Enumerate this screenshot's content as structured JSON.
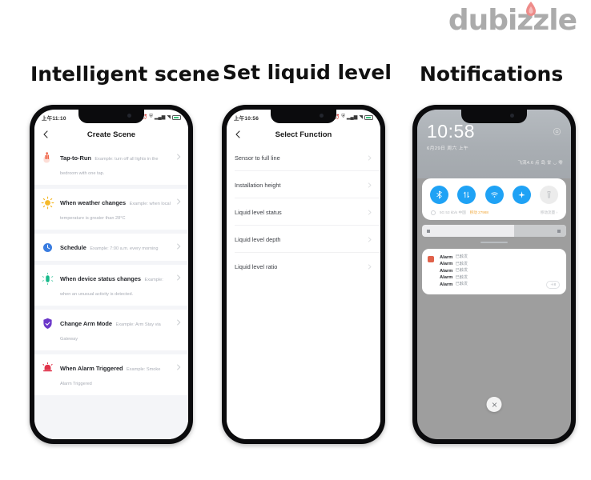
{
  "watermark": {
    "text": "dubizzle",
    "icon": "flame-icon"
  },
  "headings": {
    "first": "Intelligent scene",
    "second": "Set liquid level",
    "third": "Notifications"
  },
  "phone1": {
    "status": {
      "time": "上午11:10",
      "icons": [
        "alarm-icon",
        "vpn-icon",
        "signal-icon",
        "wifi-icon"
      ],
      "battery": "08"
    },
    "nav": {
      "back": "chevron-left-icon",
      "title": "Create Scene"
    },
    "list": [
      {
        "icon": "tap-hand-icon",
        "color": "#f0674a",
        "title": "Tap-to-Run",
        "subtitle": "Example: turn off all lights in the bedroom with one tap."
      },
      {
        "icon": "sun-weather-icon",
        "color": "#f5b92b",
        "title": "When weather changes",
        "subtitle": "Example: when local temperature is greater than 28°C"
      },
      {
        "icon": "clock-schedule-icon",
        "color": "#3a7de0",
        "title": "Schedule",
        "subtitle": "Example: 7:00 a.m. every morning"
      },
      {
        "icon": "device-sensor-icon",
        "color": "#16b98a",
        "title": "When device status changes",
        "subtitle": "Example: when an unusual activity is detected."
      },
      {
        "icon": "shield-arm-icon",
        "color": "#6b37c9",
        "title": "Change Arm Mode",
        "subtitle": "Example: Arm Stay via Gateway"
      },
      {
        "icon": "alarm-bell-icon",
        "color": "#e0334a",
        "title": "When Alarm Triggered",
        "subtitle": "Example: Smoke Alarm Triggered"
      }
    ]
  },
  "phone2": {
    "status": {
      "time": "上午10:56",
      "battery": "100"
    },
    "nav": {
      "back": "chevron-left-icon",
      "title": "Select Function"
    },
    "rows": [
      {
        "label": "Sensor to full line"
      },
      {
        "label": "Installation height"
      },
      {
        "label": "Liquid level status"
      },
      {
        "label": "Liquid level depth"
      },
      {
        "label": "Liquid level ratio"
      }
    ]
  },
  "phone3": {
    "clock": "10:58",
    "date": "6月29日 周六 上午",
    "status_right": "飞流4.6 点 岛 甘 ◡ 零",
    "gear": "settings-gear-icon",
    "toggles": [
      {
        "name": "bluetooth-toggle",
        "icon": "bluetooth-icon",
        "state": "on"
      },
      {
        "name": "mobile-data-toggle",
        "icon": "data-arrows-icon",
        "state": "on"
      },
      {
        "name": "wifi-toggle",
        "icon": "wifi-icon",
        "state": "on"
      },
      {
        "name": "airplane-mode-toggle",
        "icon": "airplane-icon",
        "state": "on"
      },
      {
        "name": "flashlight-toggle",
        "icon": "flashlight-icon",
        "state": "off"
      }
    ],
    "sub_row": {
      "left": "5G 53 kb/s 中国",
      "middle": "移动 27988",
      "right": "移动流量 ›"
    },
    "notifications": [
      {
        "app": "Alarm",
        "text": "已触发"
      },
      {
        "app": "Alarm",
        "text": "已触发"
      },
      {
        "app": "Alarm",
        "text": "已触发"
      },
      {
        "app": "Alarm",
        "text": "已触发"
      },
      {
        "app": "Alarm",
        "text": "已触发"
      }
    ],
    "notif_more": "＋8",
    "close": "close-icon"
  }
}
